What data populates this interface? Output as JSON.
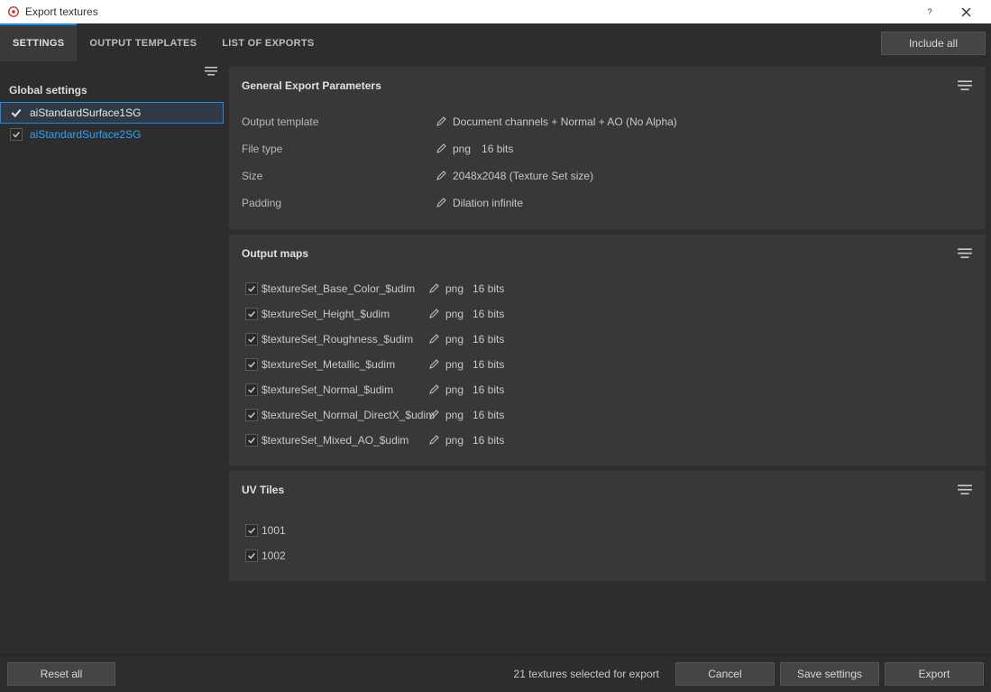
{
  "window": {
    "title": "Export textures"
  },
  "toolbar": {
    "include_all_label": "Include all"
  },
  "tabs": [
    {
      "label": "SETTINGS",
      "active": true
    },
    {
      "label": "OUTPUT TEMPLATES",
      "active": false
    },
    {
      "label": "LIST OF EXPORTS",
      "active": false
    }
  ],
  "sidebar": {
    "global_settings_label": "Global settings",
    "shaders": [
      {
        "name": "aiStandardSurface1SG",
        "checked": true,
        "selected": true,
        "hovered": false
      },
      {
        "name": "aiStandardSurface2SG",
        "checked": true,
        "selected": false,
        "hovered": true
      }
    ]
  },
  "general_params": {
    "title": "General Export Parameters",
    "rows": [
      {
        "label": "Output template",
        "value": "Document channels + Normal + AO (No Alpha)"
      },
      {
        "label": "File type",
        "value_a": "png",
        "value_b": "16 bits"
      },
      {
        "label": "Size",
        "value": "2048x2048 (Texture Set size)"
      },
      {
        "label": "Padding",
        "value": "Dilation infinite"
      }
    ]
  },
  "output_maps": {
    "title": "Output maps",
    "rows": [
      {
        "checked": true,
        "name": "$textureSet_Base_Color_$udim",
        "format": "png",
        "bits": "16 bits"
      },
      {
        "checked": true,
        "name": "$textureSet_Height_$udim",
        "format": "png",
        "bits": "16 bits"
      },
      {
        "checked": true,
        "name": "$textureSet_Roughness_$udim",
        "format": "png",
        "bits": "16 bits"
      },
      {
        "checked": true,
        "name": "$textureSet_Metallic_$udim",
        "format": "png",
        "bits": "16 bits"
      },
      {
        "checked": true,
        "name": "$textureSet_Normal_$udim",
        "format": "png",
        "bits": "16 bits"
      },
      {
        "checked": true,
        "name": "$textureSet_Normal_DirectX_$udim",
        "format": "png",
        "bits": "16 bits"
      },
      {
        "checked": true,
        "name": "$textureSet_Mixed_AO_$udim",
        "format": "png",
        "bits": "16 bits"
      }
    ]
  },
  "uv_tiles": {
    "title": "UV Tiles",
    "rows": [
      {
        "checked": true,
        "label": "1001"
      },
      {
        "checked": true,
        "label": "1002"
      }
    ]
  },
  "footer": {
    "reset_label": "Reset all",
    "status": "21 textures selected for export",
    "cancel_label": "Cancel",
    "save_label": "Save settings",
    "export_label": "Export"
  }
}
